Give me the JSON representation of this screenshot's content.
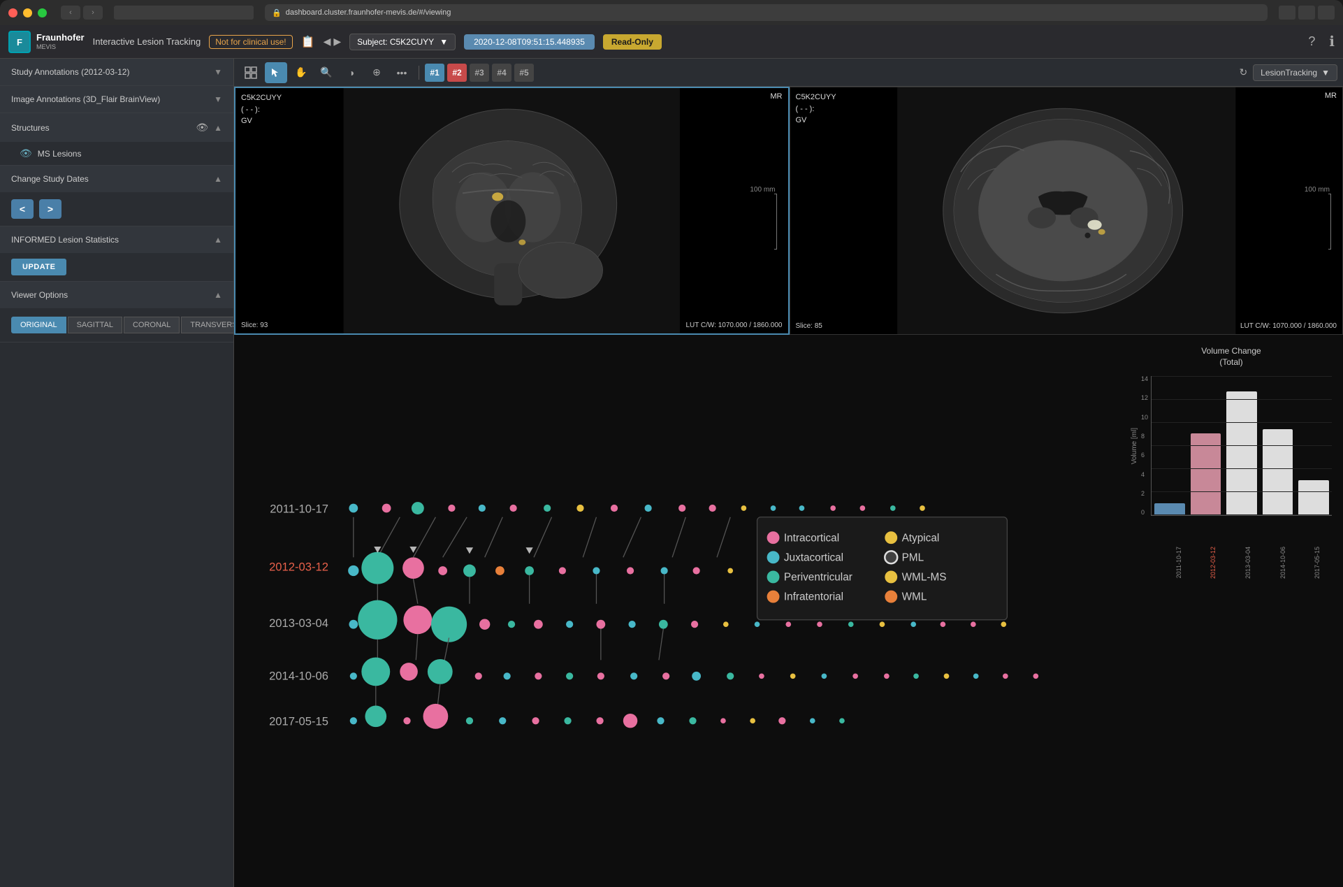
{
  "window": {
    "url": "dashboard.cluster.fraunhofer-mevis.de/#/viewing",
    "address_display": "dashboard.cluster.fraunhofer-mevis.de/#/viewing"
  },
  "header": {
    "logo_text": "F",
    "company": "Fraunhofer",
    "company_sub": "MEVIS",
    "app_title": "Interactive Lesion Tracking",
    "not_clinical": "Not for clinical use!",
    "subject_label": "Subject: C5K2CUYY",
    "date_display": "2020-12-08T09:51:15.448935",
    "read_only": "Read-Only"
  },
  "toolbar": {
    "vp1": "#1",
    "vp2": "#2",
    "vp3": "#3",
    "vp4": "#4",
    "vp5": "#5",
    "lesion_tracking": "LesionTracking"
  },
  "sidebar": {
    "study_annotations": "Study Annotations (2012-03-12)",
    "image_annotations": "Image Annotations (3D_Flair BrainView)",
    "structures": "Structures",
    "ms_lesions": "MS Lesions",
    "change_study_dates": "Change Study Dates",
    "prev_btn": "<",
    "next_btn": ">",
    "informed_stats": "INFORMED Lesion Statistics",
    "update_btn": "UPDATE",
    "viewer_options": "Viewer Options",
    "view_btns": [
      "ORIGINAL",
      "SAGITTAL",
      "CORONAL",
      "TRANSVERSAL"
    ]
  },
  "viewer1": {
    "subject": "C5K2CUYY",
    "info": "( - - ):",
    "gv": "GV",
    "modality": "MR",
    "slice": "Slice: 93",
    "lut": "LUT C/W: 1070.000 / 1860.000"
  },
  "viewer2": {
    "subject": "C5K2CUYY",
    "info": "( - - ):",
    "gv": "GV",
    "modality": "MR",
    "slice": "Slice: 85",
    "lut": "LUT C/W: 1070.000 / 1860.000"
  },
  "timeline": {
    "dates": [
      "2011-10-17",
      "2012-03-12",
      "2013-03-04",
      "2014-10-06",
      "2017-05-15"
    ],
    "active_date": "2012-03-12"
  },
  "legend": {
    "items": [
      {
        "label": "Intracortical",
        "color": "#e870a0"
      },
      {
        "label": "Atypical",
        "color": "#e8c040"
      },
      {
        "label": "Juxtacortical",
        "color": "#48b8c8"
      },
      {
        "label": "PML",
        "color": "#ddd",
        "ring": true
      },
      {
        "label": "Periventricular",
        "color": "#3ab8a0"
      },
      {
        "label": "WML-MS",
        "color": "#e8c040"
      },
      {
        "label": "Infratentorial",
        "color": "#e8803a"
      },
      {
        "label": "WML",
        "color": "#e8803a"
      }
    ]
  },
  "chart": {
    "title": "Volume Change\n(Total)",
    "y_label": "Volume [ml]",
    "y_axis": [
      "0",
      "2",
      "4",
      "6",
      "8",
      "10",
      "12",
      "14"
    ],
    "bars": [
      {
        "date": "2011-10-17",
        "value": 1.2,
        "active": false
      },
      {
        "date": "2012-03-12",
        "value": 8.2,
        "active": true
      },
      {
        "date": "2013-03-04",
        "value": 12.4,
        "active": false
      },
      {
        "date": "2014-10-06",
        "value": 8.6,
        "active": false
      },
      {
        "date": "2017-05-15",
        "value": 3.5,
        "active": false
      }
    ],
    "max_value": 14
  }
}
